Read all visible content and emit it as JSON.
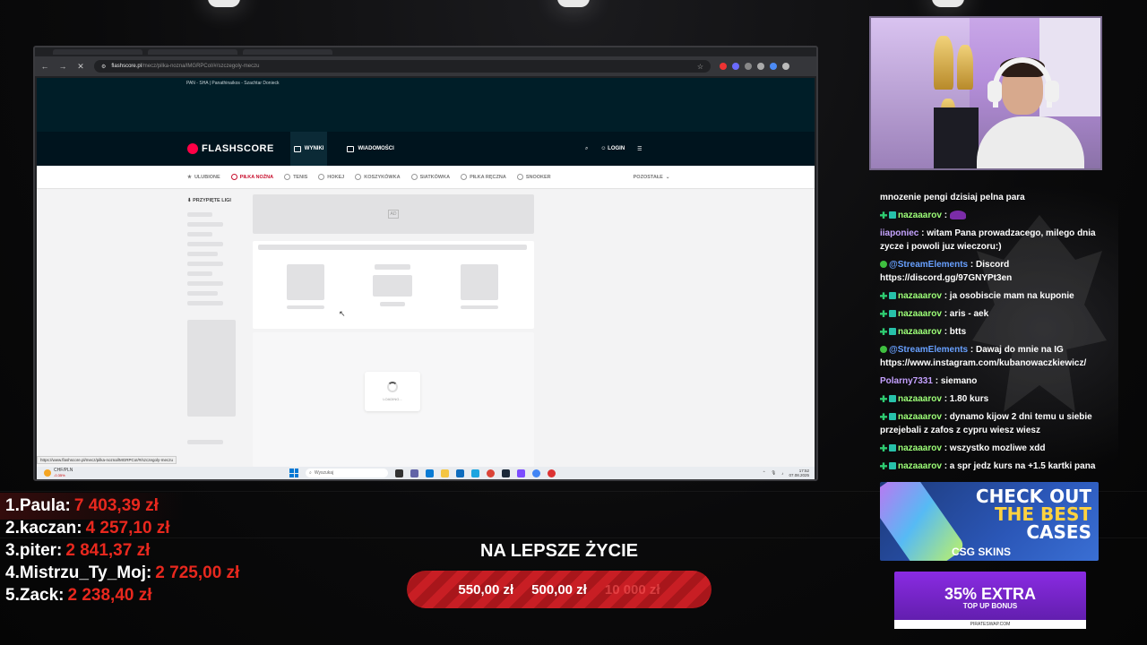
{
  "browser": {
    "url_host": "flashscore.pl",
    "url_path": "/mecz/pilka-nozna/lMGRPCoI/#/szczegoly-meczu",
    "status_url": "https://www.flashscore.pl/mecz/pilka-nozna/lMGRPCoI/#/szczegoly-meczu"
  },
  "flashscore": {
    "breadcrumb": "PAN - SHA | Panathinaikos - Szachtar Donieck",
    "logo": "FLASHSCORE",
    "nav": [
      "WYNIKI",
      "WIADOMOŚCI"
    ],
    "login": "LOGIN",
    "sports": [
      "ULUBIONE",
      "PIŁKA NOŻNA",
      "TENIS",
      "HOKEJ",
      "KOSZYKÓWKA",
      "SIATKÓWKA",
      "PIŁKA RĘCZNA",
      "SNOOKER"
    ],
    "more": "POZOSTAŁE",
    "pinned": "PRZYPIĘTE LIGI",
    "ad_badge": "AD",
    "loading": "LOADING..."
  },
  "taskbar": {
    "weather_pair": "CHF/PLN",
    "weather_change": "-0.35%",
    "search": "Wyszukaj",
    "time": "17:52",
    "date": "07.08.2025"
  },
  "chat": {
    "first_message": "mnozenie pengi dzisiaj pelna para",
    "messages": [
      {
        "badge": "b1",
        "user": "nazaaarov",
        "cls": "user-nz",
        "text": ":",
        "emote": true
      },
      {
        "badge": "",
        "user": "iiaponiec",
        "cls": "user-ia",
        "text": ": witam Pana prowadzacego, milego dnia zycze i powoli juz wieczoru:)"
      },
      {
        "badge": "b3",
        "user": "@StreamElements",
        "cls": "user-se",
        "text": ": Discord https://discord.gg/97GNYPt3en"
      },
      {
        "badge": "b1",
        "user": "nazaaarov",
        "cls": "user-nz",
        "text": ": ja osobiscie mam na kuponie"
      },
      {
        "badge": "b1",
        "user": "nazaaarov",
        "cls": "user-nz",
        "text": ": aris - aek"
      },
      {
        "badge": "b1",
        "user": "nazaaarov",
        "cls": "user-nz",
        "text": ": btts"
      },
      {
        "badge": "b3",
        "user": "@StreamElements",
        "cls": "user-se",
        "text": ": Dawaj do mnie na IG https://www.instagram.com/kubanowaczkiewicz/"
      },
      {
        "badge": "",
        "user": "Polarny7331",
        "cls": "user-po",
        "text": ": siemano"
      },
      {
        "badge": "b1",
        "user": "nazaaarov",
        "cls": "user-nz",
        "text": ": 1.80 kurs"
      },
      {
        "badge": "b1",
        "user": "nazaaarov",
        "cls": "user-nz",
        "text": ": dynamo kijow 2 dni temu u siebie przejebali z zafos z cypru wiesz wiesz"
      },
      {
        "badge": "b1",
        "user": "nazaaarov",
        "cls": "user-nz",
        "text": ": wszystko mozliwe xdd"
      },
      {
        "badge": "b1",
        "user": "nazaaarov",
        "cls": "user-nz",
        "text": ": a spr jedz kurs na +1.5 kartki pana"
      }
    ]
  },
  "ads": {
    "csg_line1": "CHECK OUT",
    "csg_line2": "THE BEST",
    "csg_line3": "CASES",
    "csg_brand": "CSG SKINS",
    "pirate_line1": "35% EXTRA",
    "pirate_line2": "TOP UP BONUS",
    "pirate_brand": "PIRATESWAP.COM"
  },
  "leaderboard": [
    {
      "rank": "1.",
      "name": "Paula:",
      "amount": "7 403,39 zł"
    },
    {
      "rank": "2.",
      "name": "kaczan:",
      "amount": "4 257,10 zł"
    },
    {
      "rank": "3.",
      "name": "piter:",
      "amount": "2 841,37 zł"
    },
    {
      "rank": "4.",
      "name": "Mistrzu_Ty_Moj:",
      "amount": "2 725,00 zł"
    },
    {
      "rank": "5.",
      "name": "Zack:",
      "amount": "2 238,40 zł"
    }
  ],
  "goal": {
    "title": "NA LEPSZE ŻYCIE",
    "current": "550,00 zł",
    "second": "500,00 zł",
    "target": "10 000 zł"
  },
  "colors": {
    "flashscore_dark": "#00141e",
    "accent_red": "#c8102e",
    "leader_amount": "#e8281e",
    "chat_user_green": "#9dff78",
    "chat_user_blue": "#68a0ff"
  }
}
